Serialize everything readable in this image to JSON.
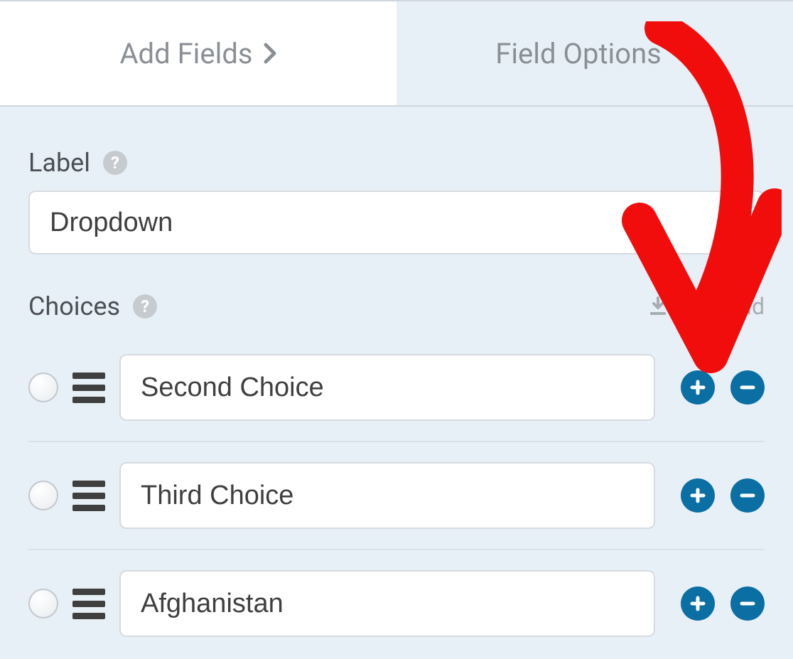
{
  "tabs": {
    "add_fields": "Add Fields",
    "field_options": "Field Options"
  },
  "labels": {
    "label_section": "Label",
    "choices_section": "Choices",
    "bulk_add": "Bulk Add"
  },
  "field": {
    "label_value": "Dropdown"
  },
  "choices": [
    {
      "value": "Second Choice"
    },
    {
      "value": "Third Choice"
    },
    {
      "value": "Afghanistan"
    }
  ],
  "colors": {
    "accent": "#0b6fa4",
    "annotation": "#f20d0d"
  }
}
